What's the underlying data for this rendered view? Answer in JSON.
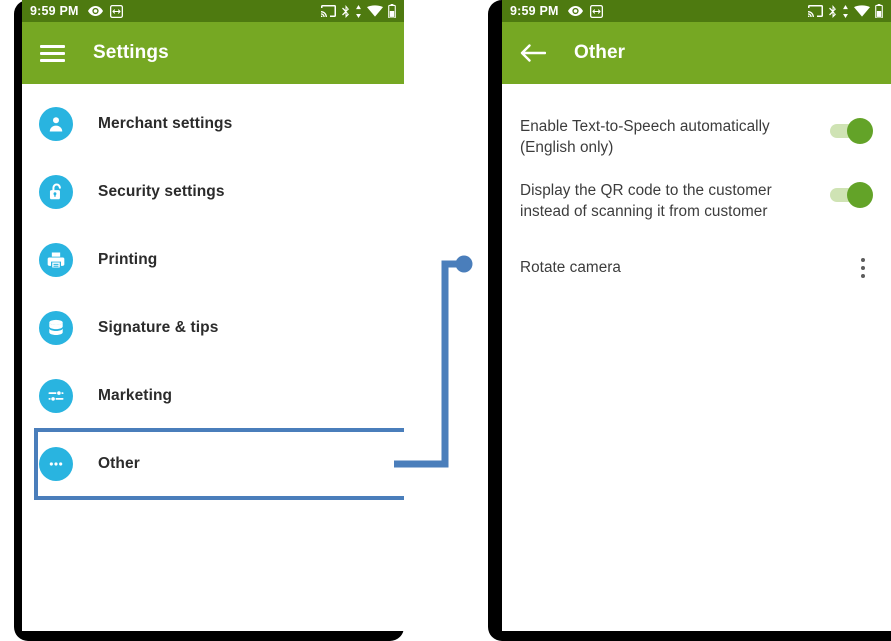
{
  "colors": {
    "status_bar_green": "#4e7a10",
    "app_bar_green": "#76a823",
    "icon_cyan": "#29b4e0",
    "annotation_blue": "#4a7ebb",
    "toggle_on_thumb": "#63a328",
    "toggle_on_track": "#cfe3b4"
  },
  "status_bar": {
    "time": "9:59 PM",
    "left_icons": [
      "eye-icon",
      "resize-arrows-icon"
    ],
    "right_icons": [
      "cast-icon",
      "bluetooth-icon",
      "signal-updown-icon",
      "wifi-icon",
      "battery-icon"
    ]
  },
  "left_phone": {
    "app_bar": {
      "menu_icon": "hamburger-menu-icon",
      "title": "Settings"
    },
    "items": [
      {
        "label": "Merchant settings",
        "icon": "person-icon"
      },
      {
        "label": "Security settings",
        "icon": "unlocked-padlock-icon"
      },
      {
        "label": "Printing",
        "icon": "printer-icon"
      },
      {
        "label": "Signature & tips",
        "icon": "database-stack-icon"
      },
      {
        "label": "Marketing",
        "icon": "sliders-icon"
      },
      {
        "label": "Other",
        "icon": "three-dots-icon"
      }
    ],
    "highlighted_item": "Other"
  },
  "right_phone": {
    "app_bar": {
      "back_icon": "back-arrow-icon",
      "title": "Other"
    },
    "rows": [
      {
        "label": "Enable Text-to-Speech automatically (English only)",
        "control": "toggle",
        "state": "on"
      },
      {
        "label": "Display the QR code to the customer instead of scanning it from customer",
        "control": "toggle",
        "state": "on"
      },
      {
        "label": "Rotate camera",
        "control": "overflow-menu",
        "state": ""
      }
    ]
  },
  "annotation": {
    "type": "callout-connector",
    "description": "Blue connector from the highlighted Other row to the right phone screen"
  }
}
